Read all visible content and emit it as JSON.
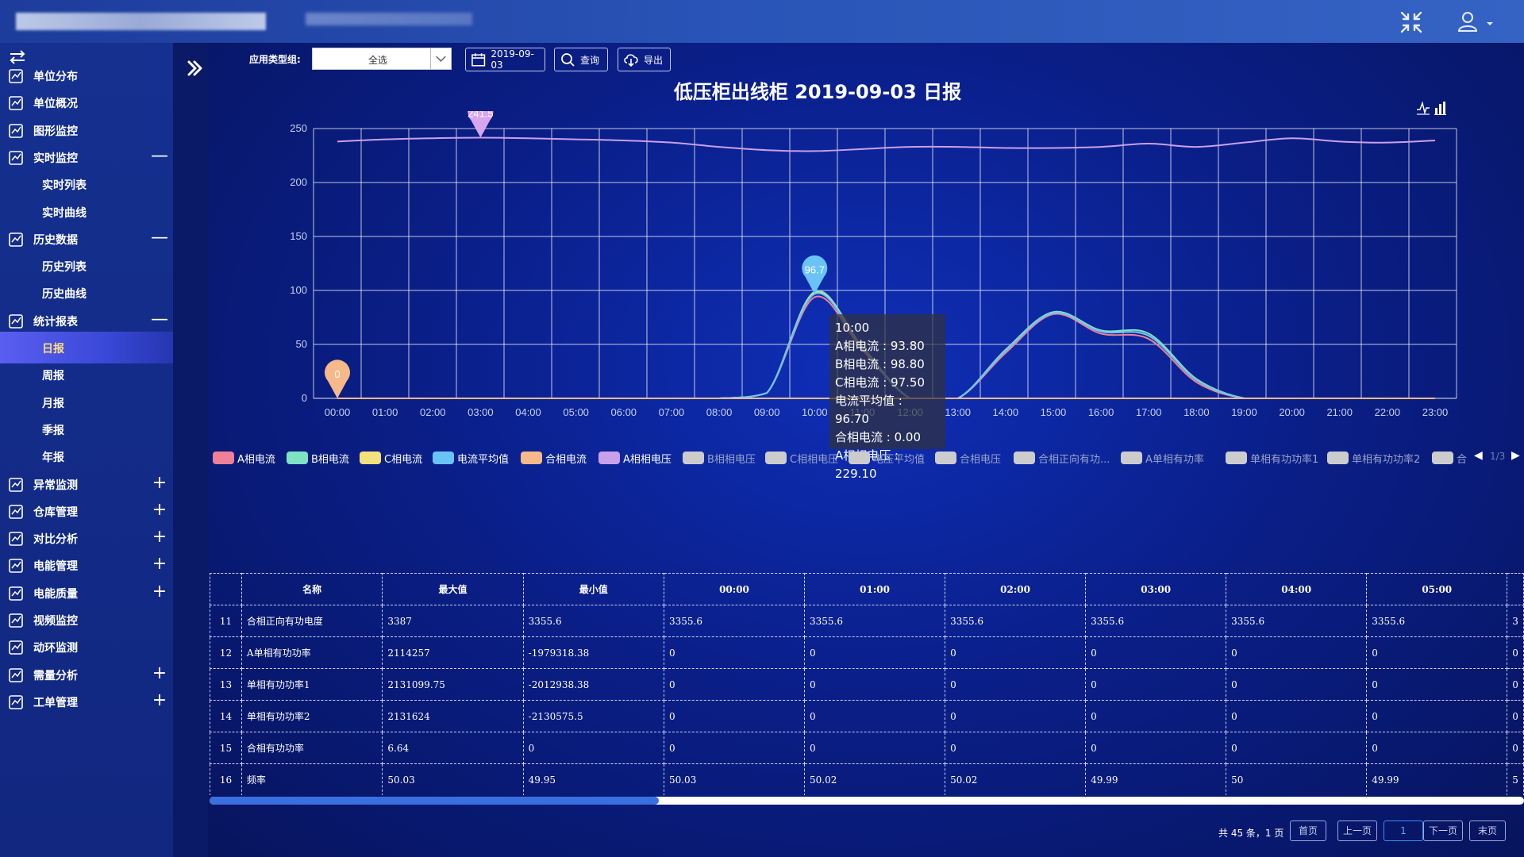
{
  "sidebar": {
    "items": [
      {
        "label": "单位分布",
        "icon": "map-pin-icon",
        "sign": ""
      },
      {
        "label": "单位概况",
        "icon": "grid-icon",
        "sign": ""
      },
      {
        "label": "图形监控",
        "icon": "image-monitor-icon",
        "sign": ""
      },
      {
        "label": "实时监控",
        "icon": "realtime-monitor-icon",
        "sign": "—"
      },
      {
        "label": "实时列表",
        "sub": true
      },
      {
        "label": "实时曲线",
        "sub": true
      },
      {
        "label": "历史数据",
        "icon": "history-chart-icon",
        "sign": "—"
      },
      {
        "label": "历史列表",
        "sub": true
      },
      {
        "label": "历史曲线",
        "sub": true
      },
      {
        "label": "统计报表",
        "icon": "report-icon",
        "sign": "—"
      },
      {
        "label": "日报",
        "sub": true,
        "active": true
      },
      {
        "label": "周报",
        "sub": true
      },
      {
        "label": "月报",
        "sub": true
      },
      {
        "label": "季报",
        "sub": true
      },
      {
        "label": "年报",
        "sub": true
      },
      {
        "label": "异常监测",
        "icon": "anomaly-icon",
        "sign": "+"
      },
      {
        "label": "仓库管理",
        "icon": "warehouse-icon",
        "sign": "+"
      },
      {
        "label": "对比分析",
        "icon": "compare-icon",
        "sign": "+"
      },
      {
        "label": "电能管理",
        "icon": "power-manage-icon",
        "sign": "+"
      },
      {
        "label": "电能质量",
        "icon": "power-quality-icon",
        "sign": "+"
      },
      {
        "label": "视频监控",
        "icon": "video-icon",
        "sign": ""
      },
      {
        "label": "动环监测",
        "icon": "environment-icon",
        "sign": ""
      },
      {
        "label": "需量分析",
        "icon": "demand-icon",
        "sign": "+"
      },
      {
        "label": "工单管理",
        "icon": "workorder-icon",
        "sign": "+"
      }
    ]
  },
  "toolbar": {
    "type_group_label": "应用类型组:",
    "type_group_value": "全选",
    "date_value": "2019-09-03",
    "query_label": "查询",
    "export_label": "导出"
  },
  "chart_title": "低压柜出线柜 2019-09-03 日报",
  "chart_data": {
    "type": "line",
    "title": "低压柜出线柜 2019-09-03 日报",
    "x": [
      "00:00",
      "01:00",
      "02:00",
      "03:00",
      "04:00",
      "05:00",
      "06:00",
      "07:00",
      "08:00",
      "09:00",
      "10:00",
      "11:00",
      "12:00",
      "13:00",
      "14:00",
      "15:00",
      "16:00",
      "17:00",
      "18:00",
      "19:00",
      "20:00",
      "21:00",
      "22:00",
      "23:00"
    ],
    "ylim": [
      0,
      250
    ],
    "yticks": [
      0,
      50,
      100,
      150,
      200,
      250
    ],
    "grid": true,
    "series": [
      {
        "name": "A相电流",
        "color": "#f07f98",
        "values": [
          0,
          0,
          0,
          0,
          0,
          0,
          0,
          0,
          0,
          5,
          93.8,
          45,
          0,
          0,
          42,
          78,
          60,
          55,
          15,
          0,
          0,
          0,
          0,
          0
        ]
      },
      {
        "name": "B相电流",
        "color": "#7de3c3",
        "values": [
          0,
          0,
          0,
          0,
          0,
          0,
          0,
          0,
          0,
          5,
          98.8,
          48,
          0,
          0,
          45,
          80,
          63,
          60,
          18,
          0,
          0,
          0,
          0,
          0
        ]
      },
      {
        "name": "C相电流",
        "color": "#f3e07a",
        "values": [
          0,
          0,
          0,
          0,
          0,
          0,
          0,
          0,
          0,
          5,
          97.5,
          47,
          0,
          0,
          44,
          79,
          62,
          58,
          17,
          0,
          0,
          0,
          0,
          0
        ]
      },
      {
        "name": "电流平均值",
        "color": "#69c3f5",
        "values": [
          0,
          0,
          0,
          0,
          0,
          0,
          0,
          0,
          0,
          5,
          96.7,
          47,
          0,
          0,
          44,
          79,
          62,
          58,
          17,
          0,
          0,
          0,
          0,
          0
        ]
      },
      {
        "name": "合相电流",
        "color": "#f7b98a",
        "values": [
          0,
          0,
          0,
          0,
          0,
          0,
          0,
          0,
          0,
          0,
          0,
          0,
          0,
          0,
          0,
          0,
          0,
          0,
          0,
          0,
          0,
          0,
          0,
          0
        ]
      },
      {
        "name": "A相相电压",
        "color": "#c9a0ea",
        "values": [
          238,
          240,
          241,
          241.5,
          241,
          240,
          239,
          237,
          233,
          230,
          229.1,
          231,
          233,
          233,
          232,
          232,
          233,
          236,
          233,
          237,
          241,
          238,
          237,
          239
        ]
      }
    ],
    "markers": [
      {
        "label": "241.5",
        "x": "03:00",
        "y": 241.5,
        "color": "#d7a6ee"
      },
      {
        "label": "96.7",
        "x": "10:00",
        "y": 96.7,
        "color": "#69c3f5"
      },
      {
        "label": "0",
        "x": "00:00",
        "y": 0,
        "color": "#f7b98a"
      }
    ],
    "legend": [
      {
        "name": "A相电流",
        "color": "#f07f98",
        "on": true
      },
      {
        "name": "B相电流",
        "color": "#7de3c3",
        "on": true
      },
      {
        "name": "C相电流",
        "color": "#f3e07a",
        "on": true
      },
      {
        "name": "电流平均值",
        "color": "#69c3f5",
        "on": true
      },
      {
        "name": "合相电流",
        "color": "#f7b98a",
        "on": true
      },
      {
        "name": "A相相电压",
        "color": "#c9a0ea",
        "on": true
      },
      {
        "name": "B相相电压",
        "color": "#cccccc",
        "on": false
      },
      {
        "name": "C相相电压",
        "color": "#cccccc",
        "on": false
      },
      {
        "name": "电压平均值",
        "color": "#cccccc",
        "on": false
      },
      {
        "name": "合相电压",
        "color": "#cccccc",
        "on": false
      },
      {
        "name": "合相正向有功...",
        "color": "#cccccc",
        "on": false
      },
      {
        "name": "A单相有功率",
        "color": "#cccccc",
        "on": false
      },
      {
        "name": "单相有功功率1",
        "color": "#cccccc",
        "on": false
      },
      {
        "name": "单相有功功率2",
        "color": "#cccccc",
        "on": false
      },
      {
        "name": "合",
        "color": "#cccccc",
        "on": false
      }
    ],
    "legend_page": "1/3"
  },
  "tooltip": {
    "lines": [
      "10:00",
      "A相电流 : 93.80",
      "B相电流 : 98.80",
      "C相电流 : 97.50",
      "电流平均值 : 96.70",
      "合相电流 : 0.00",
      "A相相电压 : 229.10"
    ]
  },
  "table": {
    "headers": [
      "",
      "名称",
      "最大值",
      "最小值",
      "00:00",
      "01:00",
      "02:00",
      "03:00",
      "04:00",
      "05:00",
      ""
    ],
    "rows": [
      [
        "11",
        "合相正向有功电度",
        "3387",
        "3355.6",
        "3355.6",
        "3355.6",
        "3355.6",
        "3355.6",
        "3355.6",
        "3355.6",
        "3"
      ],
      [
        "12",
        "A单相有功功率",
        "2114257",
        "-1979318.38",
        "0",
        "0",
        "0",
        "0",
        "0",
        "0",
        "0"
      ],
      [
        "13",
        "单相有功功率1",
        "2131099.75",
        "-2012938.38",
        "0",
        "0",
        "0",
        "0",
        "0",
        "0",
        "0"
      ],
      [
        "14",
        "单相有功功率2",
        "2131624",
        "-2130575.5",
        "0",
        "0",
        "0",
        "0",
        "0",
        "0",
        "0"
      ],
      [
        "15",
        "合相有功功率",
        "6.64",
        "0",
        "0",
        "0",
        "0",
        "0",
        "0",
        "0",
        "0"
      ],
      [
        "16",
        "频率",
        "50.03",
        "49.95",
        "50.03",
        "50.02",
        "50.02",
        "49.99",
        "50",
        "49.99",
        "5"
      ]
    ]
  },
  "pager": {
    "info": "共 45 条，1 页",
    "first": "首页",
    "prev": "上一页",
    "current": "1",
    "next": "下一页",
    "last": "末页"
  }
}
